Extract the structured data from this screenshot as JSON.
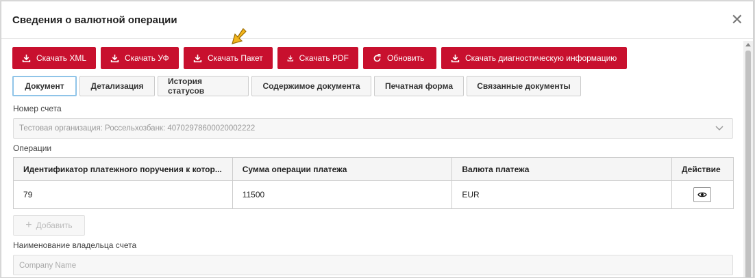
{
  "dialog": {
    "title": "Сведения о валютной операции"
  },
  "toolbar": [
    {
      "label": "Скачать XML",
      "icon": "download-icon"
    },
    {
      "label": "Скачать УФ",
      "icon": "download-icon"
    },
    {
      "label": "Скачать Пакет",
      "icon": "download-icon"
    },
    {
      "label": "Скачать PDF",
      "icon": "download-icon"
    },
    {
      "label": "Обновить",
      "icon": "refresh-icon"
    },
    {
      "label": "Скачать диагностическую информацию",
      "icon": "download-icon"
    }
  ],
  "tabs": [
    {
      "label": "Документ",
      "active": true
    },
    {
      "label": "Детализация"
    },
    {
      "label": "История статусов"
    },
    {
      "label": "Содержимое документа"
    },
    {
      "label": "Печатная форма"
    },
    {
      "label": "Связанные документы"
    }
  ],
  "account": {
    "label": "Номер счета",
    "value": "Тестовая организация: Россельхозбанк: 40702978600020002222"
  },
  "operations": {
    "label": "Операции",
    "columns": [
      "Идентификатор платежного поручения к котор...",
      "Сумма операции платежа",
      "Валюта платежа",
      "Действие"
    ],
    "rows": [
      {
        "id": "79",
        "amount": "11500",
        "currency": "EUR"
      }
    ],
    "add_label": "Добавить"
  },
  "owner": {
    "label": "Наименование владельца счета",
    "placeholder": "Company Name"
  },
  "colors": {
    "accent": "#c8102e",
    "active_tab_border": "#8fc4e8"
  }
}
